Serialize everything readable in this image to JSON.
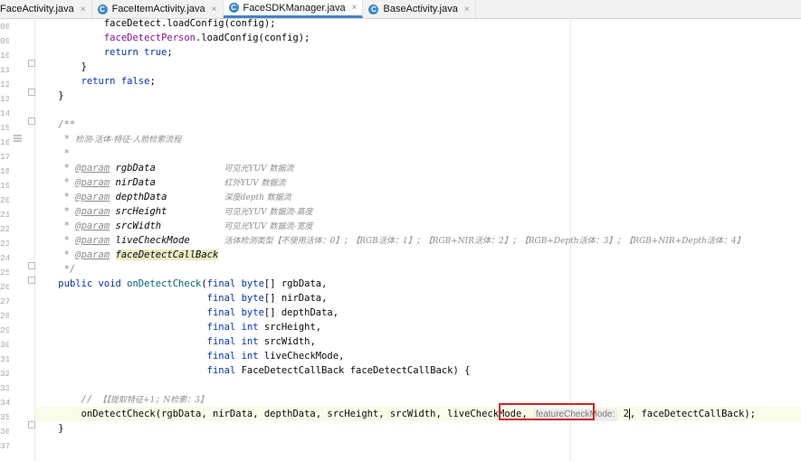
{
  "tabs": [
    {
      "label": "FaceActivity.java",
      "active": false,
      "icon": "class-icon"
    },
    {
      "label": "FaceItemActivity.java",
      "active": false,
      "icon": "class-icon"
    },
    {
      "label": "FaceSDKManager.java",
      "active": true,
      "icon": "class-icon"
    },
    {
      "label": "BaseActivity.java",
      "active": false,
      "icon": "class-icon"
    }
  ],
  "tab_close_glyph": "×",
  "tab_icon_letter": "C",
  "line_numbers": [
    "08",
    "09",
    "10",
    "11",
    "12",
    "13",
    "14",
    "15",
    "16",
    "17",
    "18",
    "19",
    "20",
    "21",
    "22",
    "23",
    "24",
    "25",
    "26",
    "27",
    "28",
    "29",
    "30",
    "31",
    "32",
    "33",
    "34",
    "35",
    "36",
    "37"
  ],
  "code": {
    "l0": "            faceDetect.loadConfig(config);",
    "l1a": "            ",
    "l1b": "faceDetectPerson",
    "l1c": ".loadConfig(config);",
    "l2a": "            ",
    "l2b": "return",
    "l2c": " ",
    "l2d": "true",
    "l2e": ";",
    "l3": "        }",
    "l4a": "        ",
    "l4b": "return",
    "l4c": " ",
    "l4d": "false",
    "l4e": ";",
    "l5": "    }",
    "l7": "    /**",
    "l8a": "     * ",
    "l8b": "检测-活体-特征-人脸检索流程",
    "l9": "     *",
    "p1a": "     * ",
    "p1tag": "@param",
    "p1n": " rgbData            ",
    "p1d": "可见光YUV 数据流",
    "p2a": "     * ",
    "p2tag": "@param",
    "p2n": " nirData            ",
    "p2d": "红外YUV 数据流",
    "p3a": "     * ",
    "p3tag": "@param",
    "p3n": " depthData          ",
    "p3d": "深度depth 数据流",
    "p4a": "     * ",
    "p4tag": "@param",
    "p4n": " srcHeight          ",
    "p4d": "可见光YUV 数据流-高度",
    "p5a": "     * ",
    "p5tag": "@param",
    "p5n": " srcWidth           ",
    "p5d": "可见光YUV 数据流-宽度",
    "p6a": "     * ",
    "p6tag": "@param",
    "p6n": " liveCheckMode      ",
    "p6d": "活体检测类型【不使用活体：0】；【RGB活体：1】；【RGB+NIR活体：2】；【RGB+Depth活体：3】；【RGB+NIR+Depth活体：4】",
    "p7a": "     * ",
    "p7tag": "@param",
    "p7s": " ",
    "p7n": "faceDetectCallBack",
    "cend": "     */",
    "s1a": "    ",
    "s1b": "public void ",
    "s1c": "onDetectCheck",
    "s1d": "(",
    "s1e": "final byte",
    "s1f": "[] rgbData,",
    "s2a": "                              ",
    "s2b": "final byte",
    "s2c": "[] nirData,",
    "s3a": "                              ",
    "s3b": "final byte",
    "s3c": "[] depthData,",
    "s4a": "                              ",
    "s4b": "final int",
    "s4c": " srcHeight,",
    "s5a": "                              ",
    "s5b": "final int",
    "s5c": " srcWidth,",
    "s6a": "                              ",
    "s6b": "final int",
    "s6c": " liveCheckMode,",
    "s7a": "                              ",
    "s7b": "final",
    "s7c": " FaceDetectCallBack faceDetectCallBack) {",
    "c1a": "        // ",
    "c1b": "【【提取特征+1；N检索：3】",
    "call_a": "        onDetectCheck(rgbData, nirData, depthData, srcHeight, srcWidth, liveCheckMode, ",
    "call_hint": "featureCheckMode:",
    "call_val": " 2",
    "call_end": ", faceDetectCallBack);",
    "close": "    }"
  }
}
